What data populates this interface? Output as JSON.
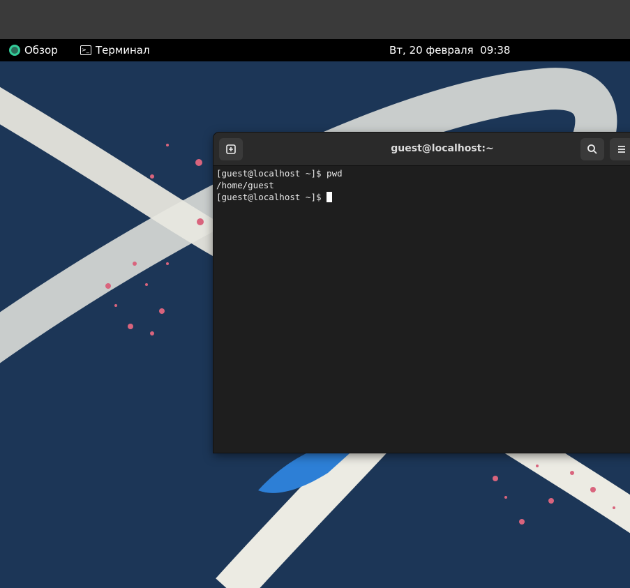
{
  "topbar": {
    "activities_label": "Обзор",
    "app_label": "Терминал",
    "clock": "Вт, 20 февраля  09:38"
  },
  "terminal": {
    "title": "guest@localhost:~",
    "lines": [
      "[guest@localhost ~]$ pwd",
      "/home/guest",
      "[guest@localhost ~]$ "
    ]
  },
  "colors": {
    "wallpaper": "#1c3657",
    "terminal_bg": "#1e1e1e",
    "header_bg": "#2a2a2a",
    "topbar_bg": "#000000"
  },
  "icons": {
    "activities": "fedora-logo-icon",
    "app": "terminal-icon",
    "new_tab": "new-tab-icon",
    "search": "search-icon",
    "menu": "hamburger-menu-icon"
  }
}
